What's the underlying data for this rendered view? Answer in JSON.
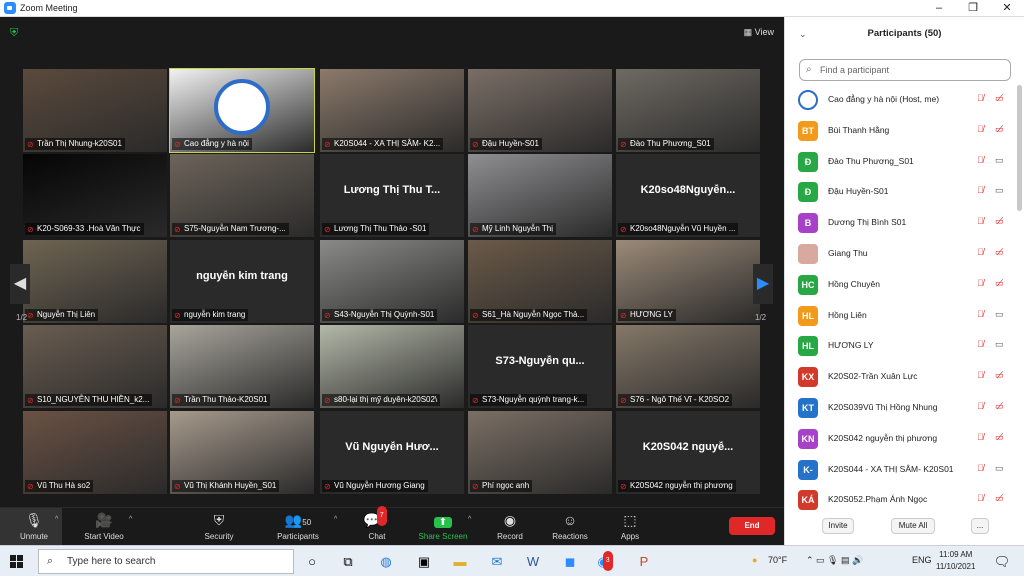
{
  "window": {
    "title": "Zoom Meeting",
    "minimize": "–",
    "maximize": "❐",
    "close": "✕"
  },
  "view_label": "▦ View",
  "page_indicator": "1/2",
  "tiles": [
    {
      "label": "Trần Thị Nhung-k20S01",
      "big": "",
      "color": "#5b4a3c"
    },
    {
      "label": "Cao đẳng y hà nội",
      "big": "",
      "color": "#f2f2f2"
    },
    {
      "label": "K20S044 - XA THỊ SÂM- K2...",
      "big": "",
      "color": "#8c7a6b"
    },
    {
      "label": "Đậu Huyền-S01",
      "big": "",
      "color": "#7a6e66"
    },
    {
      "label": "Đào Thu Phương_S01",
      "big": "",
      "color": "#6e6a63"
    },
    {
      "label": "K20-S069-33 .Hoà Văn Thực",
      "big": "",
      "color": "#050505"
    },
    {
      "label": "S75-Nguyễn Nam Trương-...",
      "big": "",
      "color": "#6d645a"
    },
    {
      "label": "Lương Thị Thu Thảo -S01",
      "big": "Lương Thị Thu T...",
      "color": ""
    },
    {
      "label": "Mỹ Linh Nguyễn Thị",
      "big": "",
      "color": "#8f8f92"
    },
    {
      "label": "K20so48Nguyễn Vũ Huyền ...",
      "big": "K20so48Nguyễn...",
      "color": ""
    },
    {
      "label": "Nguyễn Thị Liên",
      "big": "",
      "color": "#6f6452"
    },
    {
      "label": "nguyễn kim trang",
      "big": "nguyễn kim trang",
      "color": ""
    },
    {
      "label": "S43-Nguyễn Thị Quỳnh-S01",
      "big": "",
      "color": "#8a8a88"
    },
    {
      "label": "S61_Hà Nguyễn Ngọc Thả...",
      "big": "",
      "color": "#6b5a48"
    },
    {
      "label": "HƯƠNG LY",
      "big": "",
      "color": "#9b8a78"
    },
    {
      "label": "S10_NGUYỄN THU HIỀN_k2...",
      "big": "",
      "color": "#6a5d50"
    },
    {
      "label": "Trần Thu Thảo-K20S01",
      "big": "",
      "color": "#a8a59c"
    },
    {
      "label": "s80-lại thị mỹ duyên-k20S02\\",
      "big": "",
      "color": "#b4b8a8"
    },
    {
      "label": "S73-Nguyễn quỳnh trang-k...",
      "big": "S73-Nguyễn qu...",
      "color": ""
    },
    {
      "label": "S76 - Ngô Thế Vĩ - K20SO2",
      "big": "",
      "color": "#857868"
    },
    {
      "label": "Vũ Thu Hà so2",
      "big": "",
      "color": "#6a5244"
    },
    {
      "label": "Vũ Thị Khánh Huyền_S01",
      "big": "",
      "color": "#a79a8c"
    },
    {
      "label": "Vũ Nguyễn Hương Giang",
      "big": "Vũ Nguyễn Hươ...",
      "color": ""
    },
    {
      "label": "Phí ngọc anh",
      "big": "",
      "color": "#7b6f64"
    },
    {
      "label": "K20S042 nguyễn thị phương",
      "big": "K20S042 nguyễ...",
      "color": ""
    }
  ],
  "toolbar": {
    "unmute": "Unmute",
    "start_video": "Start Video",
    "security": "Security",
    "participants": "Participants",
    "participants_count": "50",
    "chat": "Chat",
    "chat_badge": "7",
    "share": "Share Screen",
    "record": "Record",
    "reactions": "Reactions",
    "apps": "Apps",
    "end": "End"
  },
  "panel": {
    "title": "Participants (50)",
    "search_placeholder": "Find a participant",
    "invite": "Invite",
    "mute_all": "Mute All",
    "more": "...",
    "participants": [
      {
        "initials": "",
        "name": "Cao đẳng y hà nội (Host, me)",
        "color": "#ffffff",
        "video": false
      },
      {
        "initials": "BT",
        "name": "Bùi Thanh Hằng",
        "color": "#f29a1c",
        "video": false
      },
      {
        "initials": "Đ",
        "name": "Đào Thu Phương_S01",
        "color": "#27a844",
        "video": true
      },
      {
        "initials": "Đ",
        "name": "Đậu Huyền-S01",
        "color": "#27a844",
        "video": true
      },
      {
        "initials": "B",
        "name": "Dương Thị Bình S01",
        "color": "#a742c8",
        "video": false
      },
      {
        "initials": "",
        "name": "Giang Thu",
        "color": "#d9a9a0",
        "video": false
      },
      {
        "initials": "HC",
        "name": "Hồng Chuyên",
        "color": "#27a844",
        "video": false
      },
      {
        "initials": "HL",
        "name": "Hồng Liên",
        "color": "#f29a1c",
        "video": true
      },
      {
        "initials": "HL",
        "name": "HƯƠNG LY",
        "color": "#27a844",
        "video": true
      },
      {
        "initials": "KX",
        "name": "K20S02-Trần Xuân Lực",
        "color": "#d13a2a",
        "video": false
      },
      {
        "initials": "KT",
        "name": "K20S039Vũ Thị Hồng Nhung",
        "color": "#2573c9",
        "video": false
      },
      {
        "initials": "KN",
        "name": "K20S042 nguyễn thị phương",
        "color": "#a742c8",
        "video": false
      },
      {
        "initials": "K-",
        "name": "K20S044 - XA THỊ SÂM- K20S01",
        "color": "#2573c9",
        "video": true
      },
      {
        "initials": "KÁ",
        "name": "K20S052.Phạm Ánh Ngọc",
        "color": "#d13a2a",
        "video": false
      }
    ]
  },
  "taskbar": {
    "search_placeholder": "Type here to search",
    "weather": "70°F",
    "lang": "ENG",
    "time": "11:09 AM",
    "date": "11/10/2021",
    "zoom_badge": "3"
  }
}
